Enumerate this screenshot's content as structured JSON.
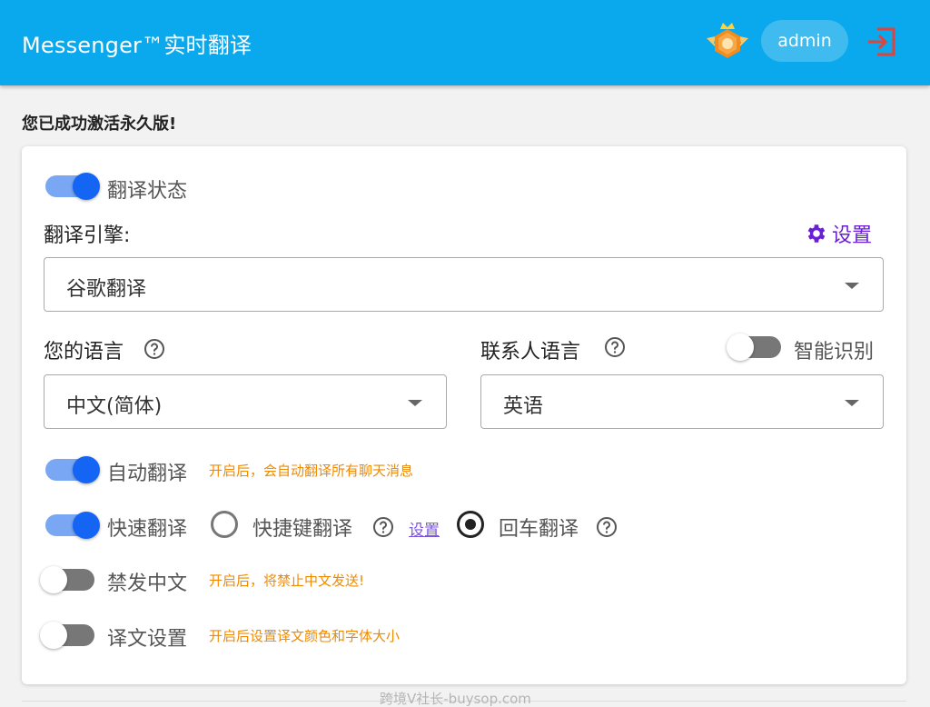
{
  "header": {
    "title": "Messenger™实时翻译",
    "user": "admin",
    "badge_icon": "crown-lion-badge-icon",
    "logout_icon": "logout-icon"
  },
  "status_message": "您已成功激活永久版!",
  "translate_status": {
    "label": "翻译状态",
    "enabled": true
  },
  "engine": {
    "label": "翻译引擎:",
    "settings_label": "设置",
    "selected": "谷歌翻译"
  },
  "your_language": {
    "label": "您的语言",
    "selected": "中文(简体)"
  },
  "contact_language": {
    "label": "联系人语言",
    "selected": "英语",
    "smart_detect_label": "智能识别",
    "smart_detect_enabled": false
  },
  "auto_translate": {
    "label": "自动翻译",
    "hint": "开启后，会自动翻译所有聊天消息",
    "enabled": true
  },
  "quick_translate": {
    "label": "快速翻译",
    "enabled": true,
    "option_hotkey": "快捷键翻译",
    "hotkey_settings": "设置",
    "option_enter": "回车翻译",
    "selected": "enter"
  },
  "block_chinese": {
    "label": "禁发中文",
    "hint": "开启后，将禁止中文发送!",
    "enabled": false
  },
  "translation_style": {
    "label": "译文设置",
    "hint": "开启后设置译文颜色和字体大小",
    "enabled": false
  },
  "watermark": "跨境V社长-buysop.com",
  "colors": {
    "header_bg": "#0aa8ec",
    "switch_on": "#1565f5",
    "hint": "#f08a00",
    "settings_link": "#6a1ed8"
  }
}
